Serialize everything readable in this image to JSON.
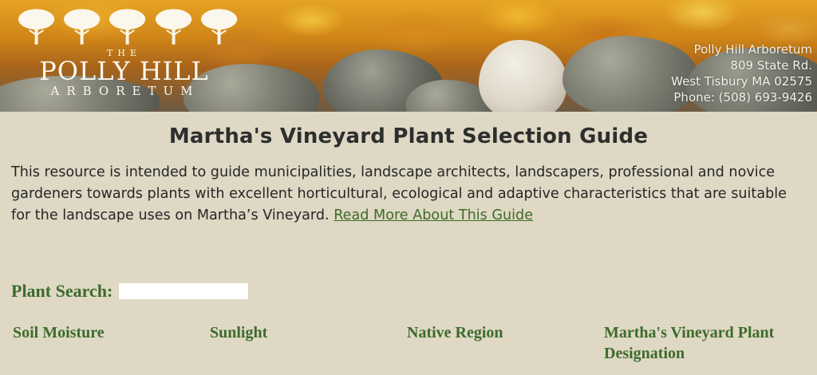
{
  "header": {
    "logo": {
      "the": "THE",
      "name": "POLLY HILL",
      "subtitle": "ARBORETUM"
    },
    "address": {
      "line1": "Polly Hill Arboretum",
      "line2": "809 State Rd.",
      "line3": "West Tisbury MA 02575",
      "line4": "Phone: (508) 693-9426"
    }
  },
  "main": {
    "title": "Martha's Vineyard Plant Selection Guide",
    "intro": "This resource is intended to guide municipalities, landscape architects, landscapers, professional and novice gardeners towards plants with excellent horticultural, ecological and adaptive characteristics that are suitable for the landscape uses on Martha’s Vineyard.",
    "read_more": "Read More About This Guide",
    "search_label": "Plant Search:",
    "search_value": "",
    "search_placeholder": "",
    "filters": [
      {
        "label": "Soil Moisture"
      },
      {
        "label": "Sunlight"
      },
      {
        "label": "Native Region"
      },
      {
        "label": "Martha's Vineyard Plant Designation"
      }
    ]
  },
  "colors": {
    "background": "#ded8c4",
    "accent_green": "#3d6b2c",
    "link_green": "#3f6b2a"
  }
}
